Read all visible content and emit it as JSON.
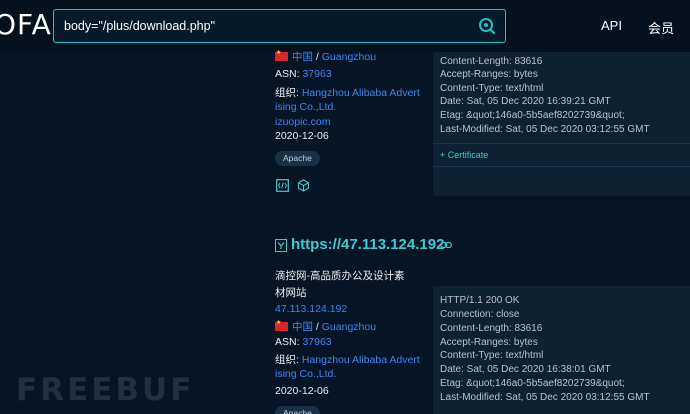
{
  "header": {
    "logo_text": "OFA",
    "search_value": "body=\"/plus/download.php\"",
    "nav_api": "API",
    "nav_member": "会员"
  },
  "result1": {
    "location_country": "中国",
    "location_city": "Guangzhou",
    "asn_label": "ASN:",
    "asn_value": "37963",
    "org_label": "组织:",
    "org_line1": "Hangzhou Alibaba Advert",
    "org_line2": "ising Co.,Ltd.",
    "domain": "izuopic.com",
    "date": "2020-12-06",
    "tag": "Apache",
    "headers": [
      "Content-Length: 83616",
      "Accept-Ranges: bytes",
      "Content-Type: text/html",
      "Date: Sat, 05 Dec 2020 16:39:21 GMT",
      "Etag: &quot;146a0-5b5aef8202739&quot;",
      "Last-Modified: Sat, 05 Dec 2020 03:12:55 GMT"
    ],
    "certificate_label": "+ Certificate"
  },
  "result2": {
    "title": "https://47.113.124.192",
    "site_name_line1": "滴控网-高品质办公及设计素",
    "site_name_line2": "材网站",
    "ip": "47.113.124.192",
    "location_country": "中国",
    "location_city": "Guangzhou",
    "asn_label": "ASN:",
    "asn_value": "37963",
    "org_label": "组织:",
    "org_line1": "Hangzhou Alibaba Advert",
    "org_line2": "ising Co.,Ltd.",
    "date": "2020-12-06",
    "tag": "Apache",
    "headers": [
      "HTTP/1.1 200 OK",
      "Connection: close",
      "Content-Length: 83616",
      "Accept-Ranges: bytes",
      "Content-Type: text/html",
      "Date: Sat, 05 Dec 2020 16:38:01 GMT",
      "Etag: &quot;146a0-5b5aef8202739&quot;",
      "Last-Modified: Sat, 05 Dec 2020 03:12:55 GMT"
    ]
  },
  "watermark": "FREEBUF",
  "colors": {
    "background": "#061525",
    "accent": "#3fcad0",
    "link": "#3d86f0",
    "panel": "#0c2131"
  }
}
